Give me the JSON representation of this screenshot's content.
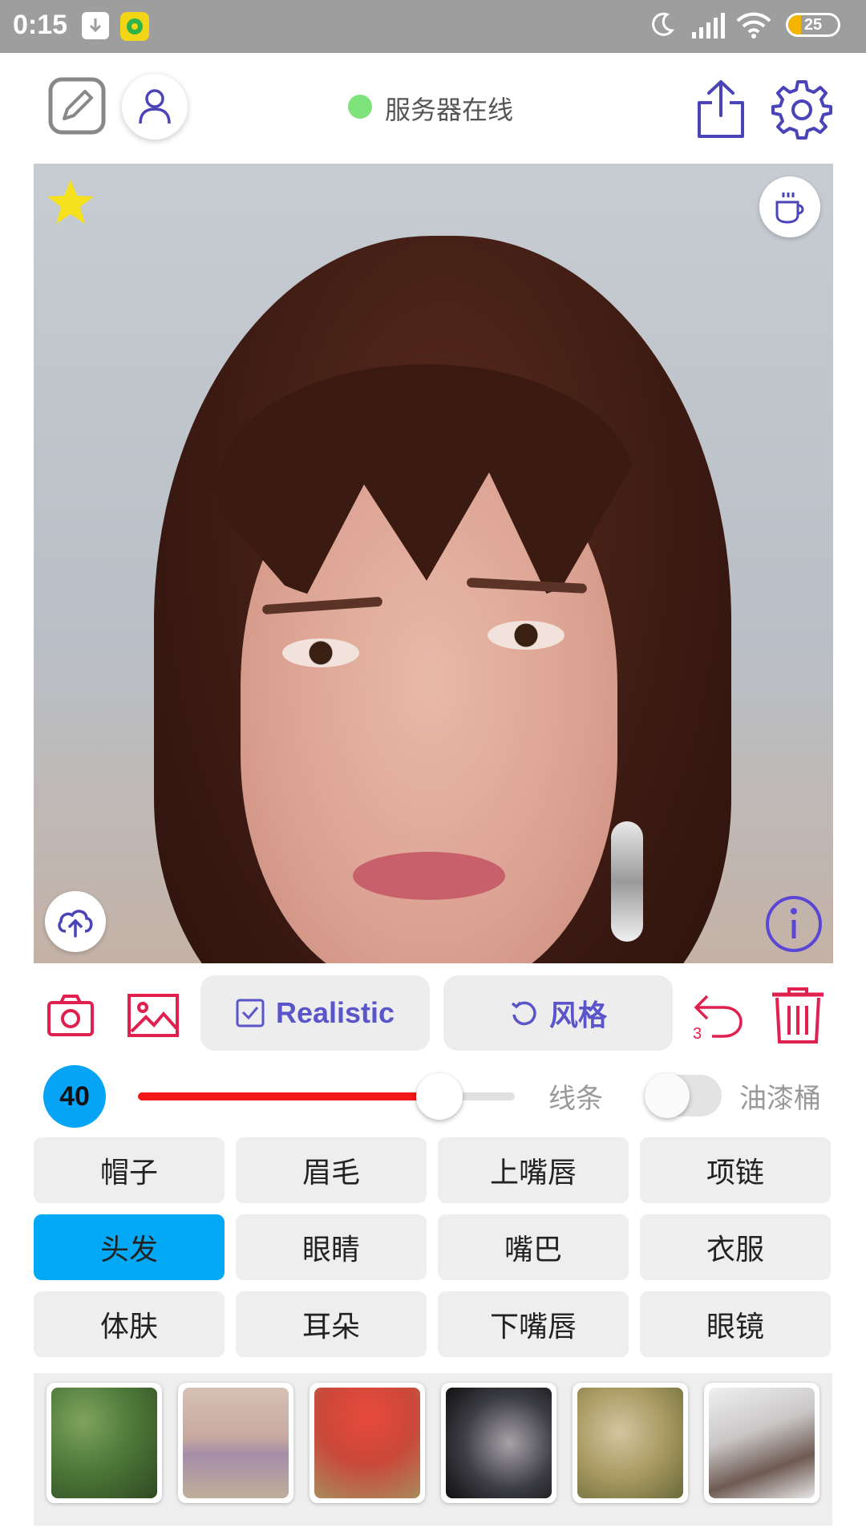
{
  "status_bar": {
    "time": "0:15",
    "battery": "25",
    "icons": [
      "download-icon",
      "music-app-icon",
      "moon-icon",
      "signal-icon",
      "wifi-icon",
      "battery-icon"
    ]
  },
  "header": {
    "server_status": "服务器在线",
    "server_status_color": "#7ee37a",
    "icons": [
      "edit-icon",
      "user-icon",
      "share-icon",
      "gear-icon"
    ],
    "accent_color": "#4a44b8"
  },
  "photo": {
    "icons": [
      "star-icon",
      "coffee-icon",
      "upload-cloud-icon",
      "info-icon"
    ]
  },
  "actions": {
    "realistic_label": "Realistic",
    "style_label": "风格",
    "undo_count": "3",
    "icons": [
      "camera-icon",
      "image-icon",
      "checkbox-icon",
      "refresh-icon",
      "undo-icon",
      "trash-icon"
    ],
    "danger_color": "#e0204f"
  },
  "brush": {
    "size": "40",
    "line_label": "线条",
    "bucket_label": "油漆桶",
    "slider_value_percent": 80,
    "bucket_enabled": false,
    "slider_color": "#f21818"
  },
  "categories": [
    {
      "label": "帽子",
      "active": false
    },
    {
      "label": "眉毛",
      "active": false
    },
    {
      "label": "上嘴唇",
      "active": false
    },
    {
      "label": "项链",
      "active": false
    },
    {
      "label": "头发",
      "active": true
    },
    {
      "label": "眼睛",
      "active": false
    },
    {
      "label": "嘴巴",
      "active": false
    },
    {
      "label": "衣服",
      "active": false
    },
    {
      "label": "体肤",
      "active": false
    },
    {
      "label": "耳朵",
      "active": false
    },
    {
      "label": "下嘴唇",
      "active": false
    },
    {
      "label": "眼镜",
      "active": false
    }
  ],
  "category_active_color": "#03a9f4",
  "textures": [
    {
      "name": "green-foliage",
      "color": "#4f7a3a"
    },
    {
      "name": "lavender-lace",
      "color": "#c7a9a0"
    },
    {
      "name": "red-leaves",
      "color": "#c9483a"
    },
    {
      "name": "dark-smoke",
      "color": "#3c3c44"
    },
    {
      "name": "golden-grass",
      "color": "#a99a62"
    },
    {
      "name": "snow-rocks",
      "color": "#8f8a8a"
    }
  ]
}
